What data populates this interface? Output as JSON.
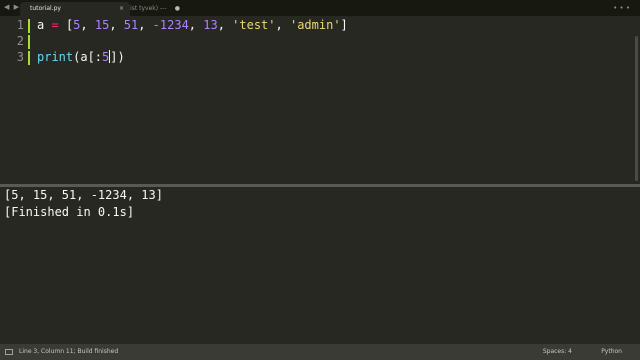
{
  "tabs": [
    {
      "label": "tutorial.py",
      "close": "×",
      "active": true
    },
    {
      "label": "--- (List tyvek) ---",
      "close": "●",
      "active": false
    }
  ],
  "window_controls": "• • •",
  "nav_arrows": "◀ ▶",
  "editor": {
    "line_numbers": [
      "1",
      "2",
      "3"
    ],
    "line1": {
      "var": "a",
      "op": "=",
      "open": "[",
      "n1": "5",
      "n2": "15",
      "n3": "51",
      "n4": "-1234",
      "n5": "13",
      "s1": "'test'",
      "s2": "'admin'",
      "close": "]"
    },
    "line3": {
      "fn": "print",
      "pre": "(a[:",
      "num": "5",
      "post": "])"
    }
  },
  "output": {
    "lines": [
      "[5, 15, 51, -1234, 13]",
      "[Finished in 0.1s]"
    ]
  },
  "statusbar": {
    "message": "Line 3, Column 11; Build finished",
    "indent": "Spaces: 4",
    "syntax": "Python"
  },
  "colors": {
    "background": "#272822",
    "keyword": "#f92672",
    "number": "#ae81ff",
    "string": "#e6db74",
    "function": "#66d9ef",
    "gutter_mark": "#a6e22e"
  }
}
